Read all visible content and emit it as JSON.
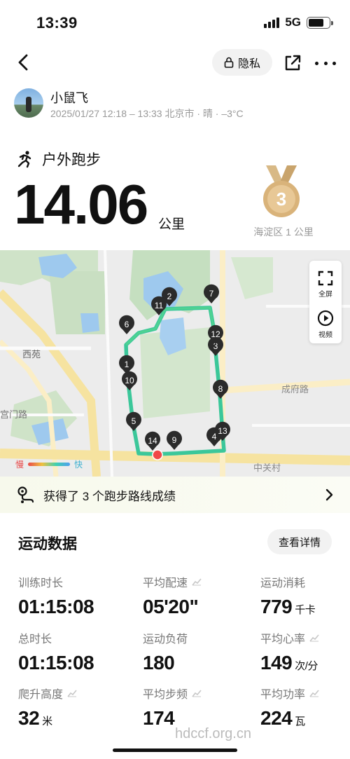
{
  "status_bar": {
    "time": "13:39",
    "network": "5G",
    "battery_level": 0.76
  },
  "nav": {
    "privacy_label": "隐私"
  },
  "user": {
    "name": "小鼠飞",
    "meta": "2025/01/27 12:18 – 13:33 北京市 · 晴 · –3°C"
  },
  "activity": {
    "type": "户外跑步",
    "distance": "14.06",
    "distance_unit": "公里",
    "medal_rank": "3",
    "medal_caption": "海淀区 1 公里"
  },
  "map": {
    "fullscreen_label": "全屏",
    "video_label": "视频",
    "legend_slow": "慢",
    "legend_fast": "快",
    "place_labels": [
      "西苑",
      "成府路",
      "宫门路",
      "中关村"
    ],
    "markers": [
      "1",
      "2",
      "3",
      "4",
      "5",
      "6",
      "7",
      "8",
      "9",
      "10",
      "11",
      "12",
      "13",
      "14"
    ],
    "route_color": "#3bc79a",
    "marker_color": "#2b2b2b",
    "start_color": "#f04848"
  },
  "achievement": {
    "text": "获得了 3 个跑步路线成绩"
  },
  "stats_section": {
    "title": "运动数据",
    "detail_button": "查看详情",
    "items": [
      {
        "label": "训练时长",
        "value": "01:15:08",
        "unit": ""
      },
      {
        "label": "平均配速",
        "value": "05'20\"",
        "unit": ""
      },
      {
        "label": "运动消耗",
        "value": "779",
        "unit": "千卡"
      },
      {
        "label": "总时长",
        "value": "01:15:08",
        "unit": ""
      },
      {
        "label": "运动负荷",
        "value": "180",
        "unit": ""
      },
      {
        "label": "平均心率",
        "value": "149",
        "unit": "次/分"
      },
      {
        "label": "爬升高度",
        "value": "32",
        "unit": "米"
      },
      {
        "label": "平均步频",
        "value": "174",
        "unit": ""
      },
      {
        "label": "平均功率",
        "value": "224",
        "unit": "瓦"
      }
    ]
  },
  "watermark": "hdccf.org.cn"
}
